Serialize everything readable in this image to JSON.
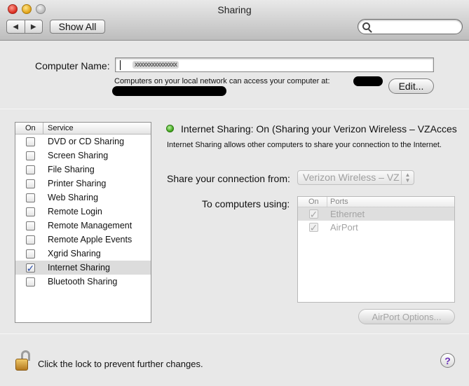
{
  "window": {
    "title": "Sharing"
  },
  "toolbar": {
    "back_icon": "◀",
    "forward_icon": "▶",
    "show_all_label": "Show All",
    "search_placeholder": ""
  },
  "computer_name": {
    "label": "Computer Name:",
    "value": "xxxxxxxxxxxxxxx",
    "access_text": "Computers on your local network can access your computer at:",
    "edit_label": "Edit..."
  },
  "services": {
    "header_on": "On",
    "header_service": "Service",
    "items": [
      {
        "label": "DVD or CD Sharing",
        "checked": false
      },
      {
        "label": "Screen Sharing",
        "checked": false
      },
      {
        "label": "File Sharing",
        "checked": false
      },
      {
        "label": "Printer Sharing",
        "checked": false
      },
      {
        "label": "Web Sharing",
        "checked": false
      },
      {
        "label": "Remote Login",
        "checked": false
      },
      {
        "label": "Remote Management",
        "checked": false
      },
      {
        "label": "Remote Apple Events",
        "checked": false
      },
      {
        "label": "Xgrid Sharing",
        "checked": false
      },
      {
        "label": "Internet Sharing",
        "checked": true,
        "selected": true
      },
      {
        "label": "Bluetooth Sharing",
        "checked": false
      }
    ]
  },
  "detail": {
    "status_text": "Internet Sharing: On (Sharing your Verizon Wireless – VZAcces",
    "status_color": "#3aa216",
    "description": "Internet Sharing allows other computers to share your connection to the Internet.",
    "share_from_label": "Share your connection from:",
    "share_from_value": "Verizon Wireless – VZ",
    "to_computers_label": "To computers using:",
    "ports_header_on": "On",
    "ports_header_ports": "Ports",
    "ports": [
      {
        "label": "Ethernet",
        "checked": true,
        "selected": true
      },
      {
        "label": "AirPort",
        "checked": true,
        "selected": false
      }
    ],
    "airport_options_label": "AirPort Options..."
  },
  "footer": {
    "lock_text": "Click the lock to prevent further changes.",
    "help_label": "?"
  }
}
